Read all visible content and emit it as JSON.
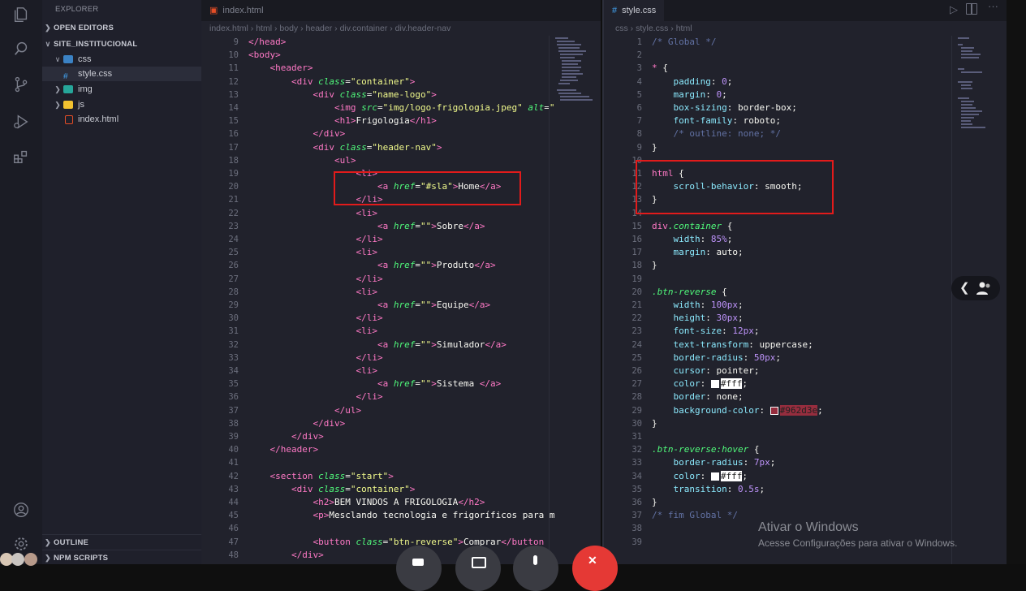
{
  "sidebar": {
    "title": "EXPLORER",
    "open_editors": "OPEN EDITORS",
    "project": "SITE_INSTITUCIONAL",
    "tree": [
      {
        "label": "css",
        "type": "folder-open"
      },
      {
        "label": "style.css",
        "type": "css"
      },
      {
        "label": "img",
        "type": "folder"
      },
      {
        "label": "js",
        "type": "folder"
      },
      {
        "label": "index.html",
        "type": "html"
      }
    ],
    "outline": "OUTLINE",
    "npm": "NPM SCRIPTS"
  },
  "left_editor": {
    "tab": "index.html",
    "breadcrumb": [
      "index.html",
      "html",
      "body",
      "header",
      "div.container",
      "div.header-nav"
    ]
  },
  "right_editor": {
    "tab": "style.css",
    "breadcrumb": [
      "css",
      "style.css",
      "html"
    ]
  },
  "icons": [
    "files-icon",
    "search-icon",
    "source-control-icon",
    "run-debug-icon",
    "extensions-icon",
    "account-icon",
    "settings-icon",
    "split-editor-icon",
    "run-icon",
    "more-icon",
    "people-icon",
    "chevron-left-icon"
  ],
  "left_lines": [
    [
      "9",
      [
        [
          "tg",
          "</head>"
        ]
      ]
    ],
    [
      "10",
      [
        [
          "tg",
          "<body>"
        ]
      ]
    ],
    [
      "11",
      [
        [
          "tx",
          "    "
        ],
        [
          "tg",
          "<header>"
        ]
      ]
    ],
    [
      "12",
      [
        [
          "tx",
          "        "
        ],
        [
          "tg",
          "<div "
        ],
        [
          "at",
          "class"
        ],
        [
          "pu",
          "="
        ],
        [
          "st",
          "\"container\""
        ],
        [
          "tg",
          ">"
        ]
      ]
    ],
    [
      "13",
      [
        [
          "tx",
          "            "
        ],
        [
          "tg",
          "<div "
        ],
        [
          "at",
          "class"
        ],
        [
          "pu",
          "="
        ],
        [
          "st",
          "\"name-logo\""
        ],
        [
          "tg",
          ">"
        ]
      ]
    ],
    [
      "14",
      [
        [
          "tx",
          "                "
        ],
        [
          "tg",
          "<img "
        ],
        [
          "at",
          "src"
        ],
        [
          "pu",
          "="
        ],
        [
          "st",
          "\"img/logo-frigologia.jpeg\""
        ],
        [
          "tx",
          " "
        ],
        [
          "at",
          "alt"
        ],
        [
          "pu",
          "="
        ],
        [
          "st",
          "\""
        ]
      ]
    ],
    [
      "15",
      [
        [
          "tx",
          "                "
        ],
        [
          "tg",
          "<h1>"
        ],
        [
          "tx",
          "Frigologia"
        ],
        [
          "tg",
          "</h1>"
        ]
      ]
    ],
    [
      "16",
      [
        [
          "tx",
          "            "
        ],
        [
          "tg",
          "</div>"
        ]
      ]
    ],
    [
      "17",
      [
        [
          "tx",
          "            "
        ],
        [
          "tg",
          "<div "
        ],
        [
          "at",
          "class"
        ],
        [
          "pu",
          "="
        ],
        [
          "st",
          "\"header-nav\""
        ],
        [
          "tg",
          ">"
        ]
      ]
    ],
    [
      "18",
      [
        [
          "tx",
          "                "
        ],
        [
          "tg",
          "<ul>"
        ]
      ]
    ],
    [
      "19",
      [
        [
          "tx",
          "                    "
        ],
        [
          "tg",
          "<li>"
        ]
      ]
    ],
    [
      "20",
      [
        [
          "tx",
          "                        "
        ],
        [
          "tg",
          "<a "
        ],
        [
          "at",
          "href"
        ],
        [
          "pu",
          "="
        ],
        [
          "st",
          "\"#sla\""
        ],
        [
          "tg",
          ">"
        ],
        [
          "tx",
          "Home"
        ],
        [
          "tg",
          "</a>"
        ]
      ]
    ],
    [
      "21",
      [
        [
          "tx",
          "                    "
        ],
        [
          "tg",
          "</li>"
        ]
      ]
    ],
    [
      "22",
      [
        [
          "tx",
          "                    "
        ],
        [
          "tg",
          "<li>"
        ]
      ]
    ],
    [
      "23",
      [
        [
          "tx",
          "                        "
        ],
        [
          "tg",
          "<a "
        ],
        [
          "at",
          "href"
        ],
        [
          "pu",
          "="
        ],
        [
          "st",
          "\"\""
        ],
        [
          "tg",
          ">"
        ],
        [
          "tx",
          "Sobre"
        ],
        [
          "tg",
          "</a>"
        ]
      ]
    ],
    [
      "24",
      [
        [
          "tx",
          "                    "
        ],
        [
          "tg",
          "</li>"
        ]
      ]
    ],
    [
      "25",
      [
        [
          "tx",
          "                    "
        ],
        [
          "tg",
          "<li>"
        ]
      ]
    ],
    [
      "26",
      [
        [
          "tx",
          "                        "
        ],
        [
          "tg",
          "<a "
        ],
        [
          "at",
          "href"
        ],
        [
          "pu",
          "="
        ],
        [
          "st",
          "\"\""
        ],
        [
          "tg",
          ">"
        ],
        [
          "tx",
          "Produto"
        ],
        [
          "tg",
          "</a>"
        ]
      ]
    ],
    [
      "27",
      [
        [
          "tx",
          "                    "
        ],
        [
          "tg",
          "</li>"
        ]
      ]
    ],
    [
      "28",
      [
        [
          "tx",
          "                    "
        ],
        [
          "tg",
          "<li>"
        ]
      ]
    ],
    [
      "29",
      [
        [
          "tx",
          "                        "
        ],
        [
          "tg",
          "<a "
        ],
        [
          "at",
          "href"
        ],
        [
          "pu",
          "="
        ],
        [
          "st",
          "\"\""
        ],
        [
          "tg",
          ">"
        ],
        [
          "tx",
          "Equipe"
        ],
        [
          "tg",
          "</a>"
        ]
      ]
    ],
    [
      "30",
      [
        [
          "tx",
          "                    "
        ],
        [
          "tg",
          "</li>"
        ]
      ]
    ],
    [
      "31",
      [
        [
          "tx",
          "                    "
        ],
        [
          "tg",
          "<li>"
        ]
      ]
    ],
    [
      "32",
      [
        [
          "tx",
          "                        "
        ],
        [
          "tg",
          "<a "
        ],
        [
          "at",
          "href"
        ],
        [
          "pu",
          "="
        ],
        [
          "st",
          "\"\""
        ],
        [
          "tg",
          ">"
        ],
        [
          "tx",
          "Simulador"
        ],
        [
          "tg",
          "</a>"
        ]
      ]
    ],
    [
      "33",
      [
        [
          "tx",
          "                    "
        ],
        [
          "tg",
          "</li>"
        ]
      ]
    ],
    [
      "34",
      [
        [
          "tx",
          "                    "
        ],
        [
          "tg",
          "<li>"
        ]
      ]
    ],
    [
      "35",
      [
        [
          "tx",
          "                        "
        ],
        [
          "tg",
          "<a "
        ],
        [
          "at",
          "href"
        ],
        [
          "pu",
          "="
        ],
        [
          "st",
          "\"\""
        ],
        [
          "tg",
          ">"
        ],
        [
          "tx",
          "Sistema "
        ],
        [
          "tg",
          "</a>"
        ]
      ]
    ],
    [
      "36",
      [
        [
          "tx",
          "                    "
        ],
        [
          "tg",
          "</li>"
        ]
      ]
    ],
    [
      "37",
      [
        [
          "tx",
          "                "
        ],
        [
          "tg",
          "</ul>"
        ]
      ]
    ],
    [
      "38",
      [
        [
          "tx",
          "            "
        ],
        [
          "tg",
          "</div>"
        ]
      ]
    ],
    [
      "39",
      [
        [
          "tx",
          "        "
        ],
        [
          "tg",
          "</div>"
        ]
      ]
    ],
    [
      "40",
      [
        [
          "tx",
          "    "
        ],
        [
          "tg",
          "</header>"
        ]
      ]
    ],
    [
      "41",
      []
    ],
    [
      "42",
      [
        [
          "tx",
          "    "
        ],
        [
          "tg",
          "<section "
        ],
        [
          "at",
          "class"
        ],
        [
          "pu",
          "="
        ],
        [
          "st",
          "\"start\""
        ],
        [
          "tg",
          ">"
        ]
      ]
    ],
    [
      "43",
      [
        [
          "tx",
          "        "
        ],
        [
          "tg",
          "<div "
        ],
        [
          "at",
          "class"
        ],
        [
          "pu",
          "="
        ],
        [
          "st",
          "\"container\""
        ],
        [
          "tg",
          ">"
        ]
      ]
    ],
    [
      "44",
      [
        [
          "tx",
          "            "
        ],
        [
          "tg",
          "<h2>"
        ],
        [
          "tx",
          "BEM VINDOS A FRIGOLOGIA"
        ],
        [
          "tg",
          "</h2>"
        ]
      ]
    ],
    [
      "45",
      [
        [
          "tx",
          "            "
        ],
        [
          "tg",
          "<p>"
        ],
        [
          "tx",
          "Mesclando tecnologia e frigoríficos para m"
        ]
      ]
    ],
    [
      "46",
      []
    ],
    [
      "47",
      [
        [
          "tx",
          "            "
        ],
        [
          "tg",
          "<button "
        ],
        [
          "at",
          "class"
        ],
        [
          "pu",
          "="
        ],
        [
          "st",
          "\"btn-reverse\""
        ],
        [
          "tg",
          ">"
        ],
        [
          "tx",
          "Comprar"
        ],
        [
          "tg",
          "</button"
        ]
      ]
    ],
    [
      "48",
      [
        [
          "tx",
          "        "
        ],
        [
          "tg",
          "</div>"
        ]
      ]
    ]
  ],
  "right_lines": [
    [
      "1",
      [
        [
          "cm",
          "/* Global */"
        ]
      ]
    ],
    [
      "2",
      []
    ],
    [
      "3",
      [
        [
          "kw",
          "* "
        ],
        [
          "pu",
          "{"
        ]
      ]
    ],
    [
      "4",
      [
        [
          "tx",
          "    "
        ],
        [
          "pr",
          "padding"
        ],
        [
          "pu",
          ": "
        ],
        [
          "nu",
          "0"
        ],
        [
          "pu",
          ";"
        ]
      ]
    ],
    [
      "5",
      [
        [
          "tx",
          "    "
        ],
        [
          "pr",
          "margin"
        ],
        [
          "pu",
          ": "
        ],
        [
          "nu",
          "0"
        ],
        [
          "pu",
          ";"
        ]
      ]
    ],
    [
      "6",
      [
        [
          "tx",
          "    "
        ],
        [
          "pr",
          "box-sizing"
        ],
        [
          "pu",
          ": "
        ],
        [
          "tx",
          "border-box;"
        ]
      ]
    ],
    [
      "7",
      [
        [
          "tx",
          "    "
        ],
        [
          "pr",
          "font-family"
        ],
        [
          "pu",
          ": "
        ],
        [
          "tx",
          "roboto;"
        ]
      ]
    ],
    [
      "8",
      [
        [
          "tx",
          "    "
        ],
        [
          "cm",
          "/* outline: none; */"
        ]
      ]
    ],
    [
      "9",
      [
        [
          "pu",
          "}"
        ]
      ]
    ],
    [
      "10",
      []
    ],
    [
      "11",
      [
        [
          "kw",
          "html "
        ],
        [
          "pu",
          "{"
        ]
      ]
    ],
    [
      "12",
      [
        [
          "tx",
          "    "
        ],
        [
          "pr",
          "scroll-behavior"
        ],
        [
          "pu",
          ": "
        ],
        [
          "tx",
          "smooth;"
        ]
      ]
    ],
    [
      "13",
      [
        [
          "pu",
          "}"
        ]
      ]
    ],
    [
      "14",
      []
    ],
    [
      "15",
      [
        [
          "kw",
          "div"
        ],
        [
          "cl",
          ".container"
        ],
        [
          "pu",
          " {"
        ]
      ]
    ],
    [
      "16",
      [
        [
          "tx",
          "    "
        ],
        [
          "pr",
          "width"
        ],
        [
          "pu",
          ": "
        ],
        [
          "nu",
          "85%"
        ],
        [
          "pu",
          ";"
        ]
      ]
    ],
    [
      "17",
      [
        [
          "tx",
          "    "
        ],
        [
          "pr",
          "margin"
        ],
        [
          "pu",
          ": "
        ],
        [
          "tx",
          "auto;"
        ]
      ]
    ],
    [
      "18",
      [
        [
          "pu",
          "}"
        ]
      ]
    ],
    [
      "19",
      []
    ],
    [
      "20",
      [
        [
          "cl",
          ".btn-reverse"
        ],
        [
          "pu",
          " {"
        ]
      ]
    ],
    [
      "21",
      [
        [
          "tx",
          "    "
        ],
        [
          "pr",
          "width"
        ],
        [
          "pu",
          ": "
        ],
        [
          "nu",
          "100px"
        ],
        [
          "pu",
          ";"
        ]
      ]
    ],
    [
      "22",
      [
        [
          "tx",
          "    "
        ],
        [
          "pr",
          "height"
        ],
        [
          "pu",
          ": "
        ],
        [
          "nu",
          "30px"
        ],
        [
          "pu",
          ";"
        ]
      ]
    ],
    [
      "23",
      [
        [
          "tx",
          "    "
        ],
        [
          "pr",
          "font-size"
        ],
        [
          "pu",
          ": "
        ],
        [
          "nu",
          "12px"
        ],
        [
          "pu",
          ";"
        ]
      ]
    ],
    [
      "24",
      [
        [
          "tx",
          "    "
        ],
        [
          "pr",
          "text-transform"
        ],
        [
          "pu",
          ": "
        ],
        [
          "tx",
          "uppercase;"
        ]
      ]
    ],
    [
      "25",
      [
        [
          "tx",
          "    "
        ],
        [
          "pr",
          "border-radius"
        ],
        [
          "pu",
          ": "
        ],
        [
          "nu",
          "50px"
        ],
        [
          "pu",
          ";"
        ]
      ]
    ],
    [
      "26",
      [
        [
          "tx",
          "    "
        ],
        [
          "pr",
          "cursor"
        ],
        [
          "pu",
          ": "
        ],
        [
          "tx",
          "pointer;"
        ]
      ]
    ],
    [
      "27",
      [
        [
          "tx",
          "    "
        ],
        [
          "pr",
          "color"
        ],
        [
          "pu",
          ": "
        ],
        [
          "sw",
          "#fff"
        ],
        [
          "hw",
          "#fff"
        ],
        [
          "pu",
          ";"
        ]
      ]
    ],
    [
      "28",
      [
        [
          "tx",
          "    "
        ],
        [
          "pr",
          "border"
        ],
        [
          "pu",
          ": "
        ],
        [
          "tx",
          "none;"
        ]
      ]
    ],
    [
      "29",
      [
        [
          "tx",
          "    "
        ],
        [
          "pr",
          "background-color"
        ],
        [
          "pu",
          ": "
        ],
        [
          "sw",
          "#962d3e"
        ],
        [
          "hr",
          "#962d3e"
        ],
        [
          "pu",
          ";"
        ]
      ]
    ],
    [
      "30",
      [
        [
          "pu",
          "}"
        ]
      ]
    ],
    [
      "31",
      []
    ],
    [
      "32",
      [
        [
          "cl",
          ".btn-reverse:hover"
        ],
        [
          "pu",
          " {"
        ]
      ]
    ],
    [
      "33",
      [
        [
          "tx",
          "    "
        ],
        [
          "pr",
          "border-radius"
        ],
        [
          "pu",
          ": "
        ],
        [
          "nu",
          "7px"
        ],
        [
          "pu",
          ";"
        ]
      ]
    ],
    [
      "34",
      [
        [
          "tx",
          "    "
        ],
        [
          "pr",
          "color"
        ],
        [
          "pu",
          ": "
        ],
        [
          "sw",
          "#fff"
        ],
        [
          "hw",
          "#fff"
        ],
        [
          "pu",
          ";"
        ]
      ]
    ],
    [
      "35",
      [
        [
          "tx",
          "    "
        ],
        [
          "pr",
          "transition"
        ],
        [
          "pu",
          ": "
        ],
        [
          "nu",
          "0.5s"
        ],
        [
          "pu",
          ";"
        ]
      ]
    ],
    [
      "36",
      [
        [
          "pu",
          "}"
        ]
      ]
    ],
    [
      "37",
      [
        [
          "cm",
          "/* fim Global */"
        ]
      ]
    ],
    [
      "38",
      []
    ],
    [
      "39",
      []
    ]
  ],
  "watermark": {
    "title": "Ativar o Windows",
    "subtitle": "Acesse Configurações para ativar o Windows."
  }
}
